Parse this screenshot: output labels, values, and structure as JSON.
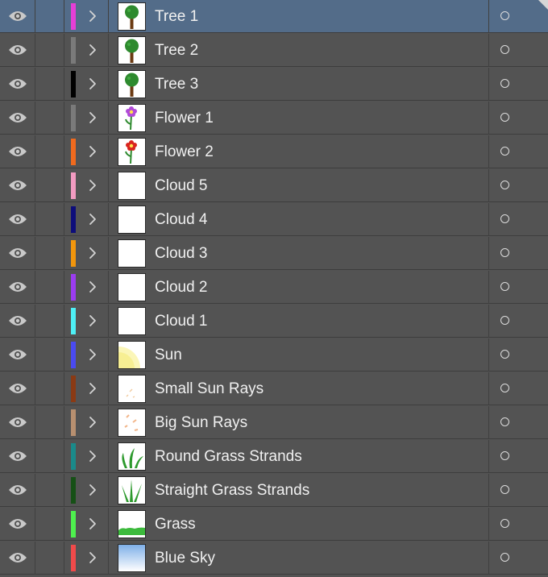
{
  "layers": [
    {
      "name": "Tree 1",
      "color": "#e63fd6",
      "thumb": "tree",
      "selected": true
    },
    {
      "name": "Tree 2",
      "color": "#7a7a7a",
      "thumb": "tree",
      "selected": false
    },
    {
      "name": "Tree 3",
      "color": "#000000",
      "thumb": "tree",
      "selected": false
    },
    {
      "name": "Flower 1",
      "color": "#7a7a7a",
      "thumb": "flower-purple",
      "selected": false
    },
    {
      "name": "Flower 2",
      "color": "#f06a1e",
      "thumb": "flower-red",
      "selected": false
    },
    {
      "name": "Cloud 5",
      "color": "#f29bc1",
      "thumb": "blank",
      "selected": false
    },
    {
      "name": "Cloud 4",
      "color": "#0d0d7a",
      "thumb": "blank",
      "selected": false
    },
    {
      "name": "Cloud 3",
      "color": "#f2960c",
      "thumb": "blank",
      "selected": false
    },
    {
      "name": "Cloud 2",
      "color": "#9b3cf0",
      "thumb": "blank",
      "selected": false
    },
    {
      "name": "Cloud 1",
      "color": "#4ef0f5",
      "thumb": "blank",
      "selected": false
    },
    {
      "name": "Sun",
      "color": "#4a4af0",
      "thumb": "sun",
      "selected": false
    },
    {
      "name": "Small Sun Rays",
      "color": "#8a3a14",
      "thumb": "small-rays",
      "selected": false
    },
    {
      "name": "Big Sun Rays",
      "color": "#b89070",
      "thumb": "big-rays",
      "selected": false
    },
    {
      "name": "Round Grass Strands",
      "color": "#1a8a8a",
      "thumb": "round-grass",
      "selected": false
    },
    {
      "name": "Straight Grass Strands",
      "color": "#165016",
      "thumb": "straight-grass",
      "selected": false
    },
    {
      "name": "Grass",
      "color": "#4ef04e",
      "thumb": "grass",
      "selected": false
    },
    {
      "name": "Blue Sky",
      "color": "#f04a4a",
      "thumb": "sky",
      "selected": false
    }
  ]
}
